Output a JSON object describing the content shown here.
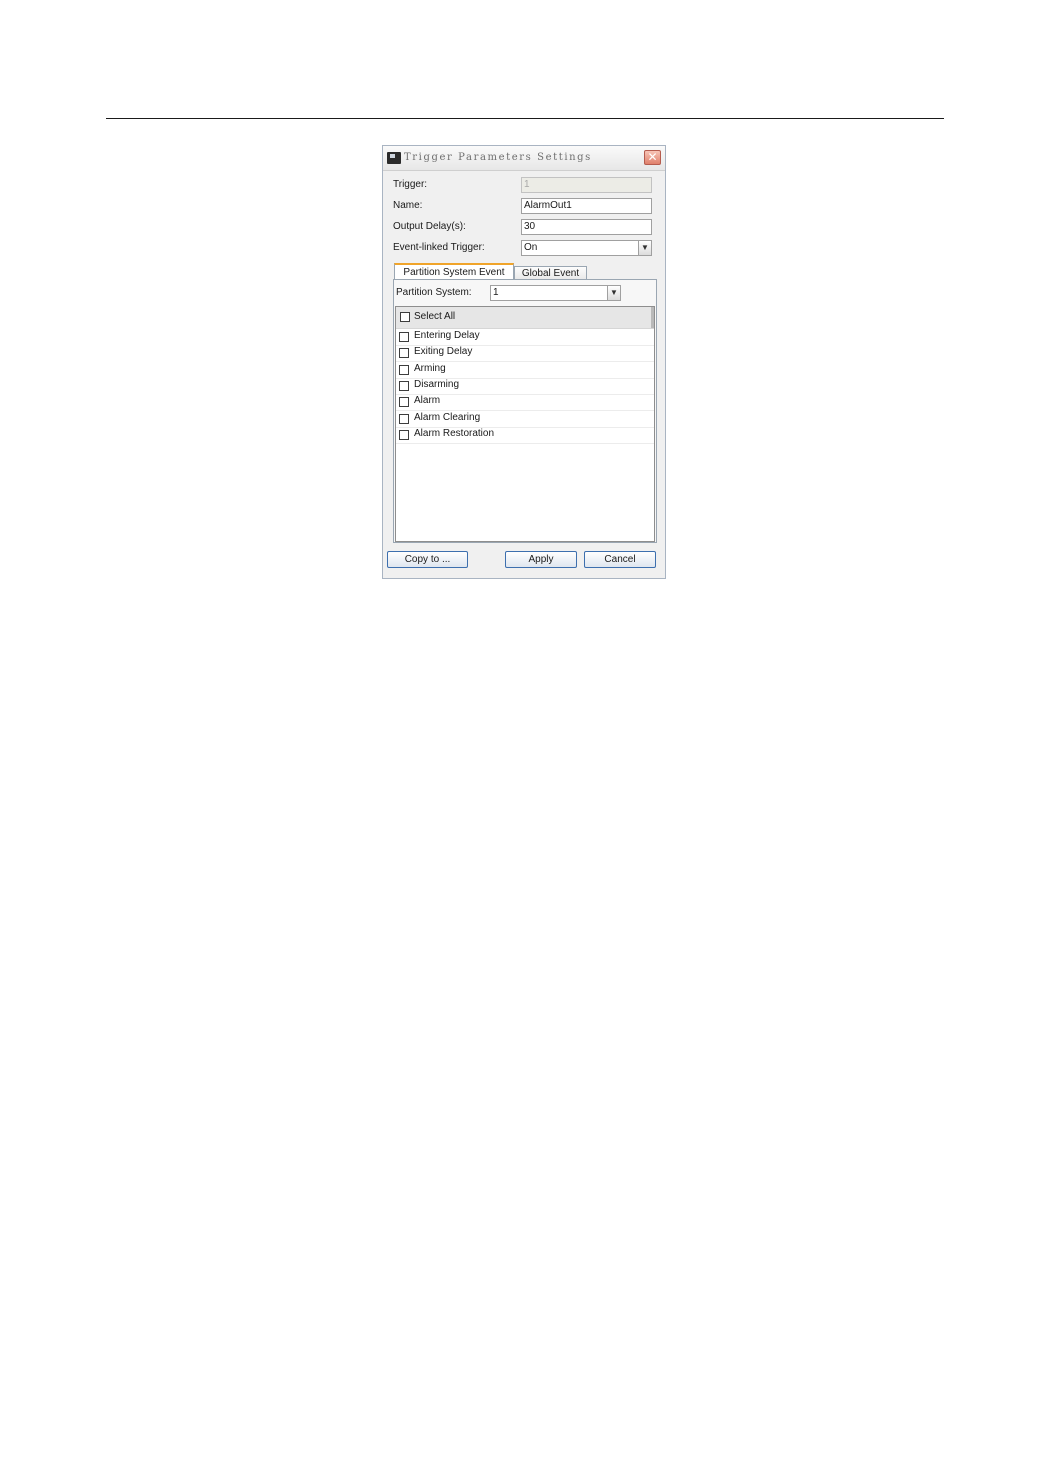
{
  "dialog": {
    "title": "Trigger Parameters Settings",
    "close_glyph": "✕"
  },
  "form": {
    "trigger": {
      "label": "Trigger:",
      "value": "1"
    },
    "name": {
      "label": "Name:",
      "value": "AlarmOut1"
    },
    "output_delay": {
      "label": "Output Delay(s):",
      "value": "30"
    },
    "event_linked": {
      "label": "Event-linked Trigger:",
      "value": "On"
    }
  },
  "tabs": [
    {
      "label": "Partition System Event",
      "selected": true
    },
    {
      "label": "Global Event",
      "selected": false
    }
  ],
  "partition": {
    "label": "Partition System:",
    "value": "1"
  },
  "list": {
    "select_all": "Select All",
    "items": [
      "Entering Delay",
      "Exiting Delay",
      "Arming",
      "Disarming",
      "Alarm",
      "Alarm Clearing",
      "Alarm Restoration"
    ]
  },
  "buttons": {
    "copy_to": "Copy to ...",
    "apply": "Apply",
    "cancel": "Cancel"
  },
  "icons": {
    "dropdown": "chevron-down-icon",
    "close": "close-icon",
    "app": "app-icon"
  },
  "colors": {
    "tab_accent": "#f0a42a",
    "button_border": "#3d6fae",
    "close_button": "#e0806c"
  }
}
